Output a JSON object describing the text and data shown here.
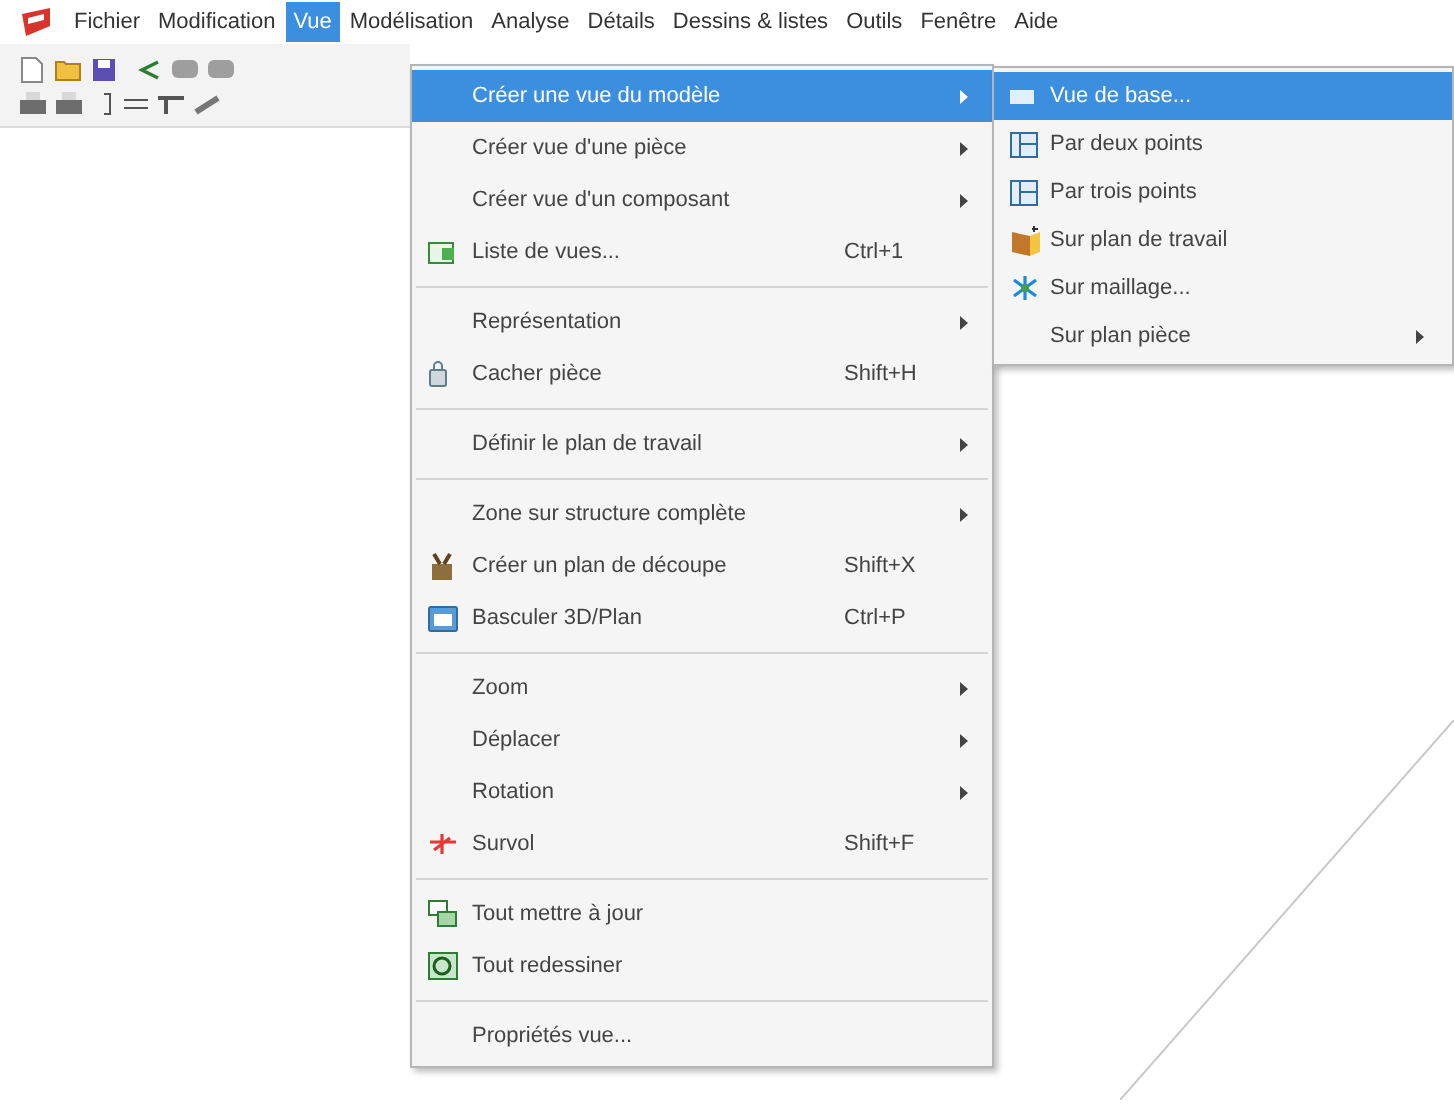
{
  "menu_bar": [
    {
      "label": "Fichier",
      "selected": false
    },
    {
      "label": "Modification",
      "selected": false
    },
    {
      "label": "Vue",
      "selected": true
    },
    {
      "label": "Modélisation",
      "selected": false
    },
    {
      "label": "Analyse",
      "selected": false
    },
    {
      "label": "Détails",
      "selected": false
    },
    {
      "label": "Dessins & listes",
      "selected": false
    },
    {
      "label": "Outils",
      "selected": false
    },
    {
      "label": "Fenêtre",
      "selected": false
    },
    {
      "label": "Aide",
      "selected": false
    }
  ],
  "view_menu": [
    {
      "kind": "item",
      "label": "Créer une vue du modèle",
      "submenu": true,
      "selected": true
    },
    {
      "kind": "item",
      "label": "Créer vue d'une pièce",
      "submenu": true,
      "selected": false
    },
    {
      "kind": "item",
      "label": "Créer vue d'un composant",
      "submenu": true,
      "selected": false
    },
    {
      "kind": "item",
      "label": "Liste de vues...",
      "shortcut": "Ctrl+1",
      "submenu": false,
      "selected": false
    },
    {
      "kind": "separator"
    },
    {
      "kind": "item",
      "label": "Représentation",
      "submenu": true,
      "selected": false
    },
    {
      "kind": "item",
      "label": "Cacher pièce",
      "shortcut": "Shift+H",
      "submenu": false,
      "selected": false
    },
    {
      "kind": "separator"
    },
    {
      "kind": "item",
      "label": "Définir le plan de travail",
      "submenu": true,
      "selected": false
    },
    {
      "kind": "separator"
    },
    {
      "kind": "item",
      "label": "Zone sur structure complète",
      "submenu": true,
      "selected": false
    },
    {
      "kind": "item",
      "label": "Créer un plan de découpe",
      "shortcut": "Shift+X",
      "submenu": false,
      "selected": false
    },
    {
      "kind": "item",
      "label": "Basculer 3D/Plan",
      "shortcut": "Ctrl+P",
      "submenu": false,
      "selected": false
    },
    {
      "kind": "separator"
    },
    {
      "kind": "item",
      "label": "Zoom",
      "submenu": true,
      "selected": false
    },
    {
      "kind": "item",
      "label": "Déplacer",
      "submenu": true,
      "selected": false
    },
    {
      "kind": "item",
      "label": "Rotation",
      "submenu": true,
      "selected": false
    },
    {
      "kind": "item",
      "label": "Survol",
      "shortcut": "Shift+F",
      "submenu": false,
      "selected": false
    },
    {
      "kind": "separator"
    },
    {
      "kind": "item",
      "label": "Tout mettre à jour",
      "submenu": false,
      "selected": false
    },
    {
      "kind": "item",
      "label": "Tout redessiner",
      "submenu": false,
      "selected": false
    },
    {
      "kind": "separator"
    },
    {
      "kind": "item",
      "label": "Propriétés vue...",
      "submenu": false,
      "selected": false
    }
  ],
  "model_view_submenu": [
    {
      "label": "Vue de base...",
      "submenu": false,
      "selected": true
    },
    {
      "label": "Par deux points",
      "submenu": false,
      "selected": false
    },
    {
      "label": "Par trois points",
      "submenu": false,
      "selected": false
    },
    {
      "label": "Sur plan de travail",
      "submenu": false,
      "selected": false
    },
    {
      "label": "Sur maillage...",
      "submenu": false,
      "selected": false
    },
    {
      "label": "Sur plan pièce",
      "submenu": true,
      "selected": false
    }
  ]
}
